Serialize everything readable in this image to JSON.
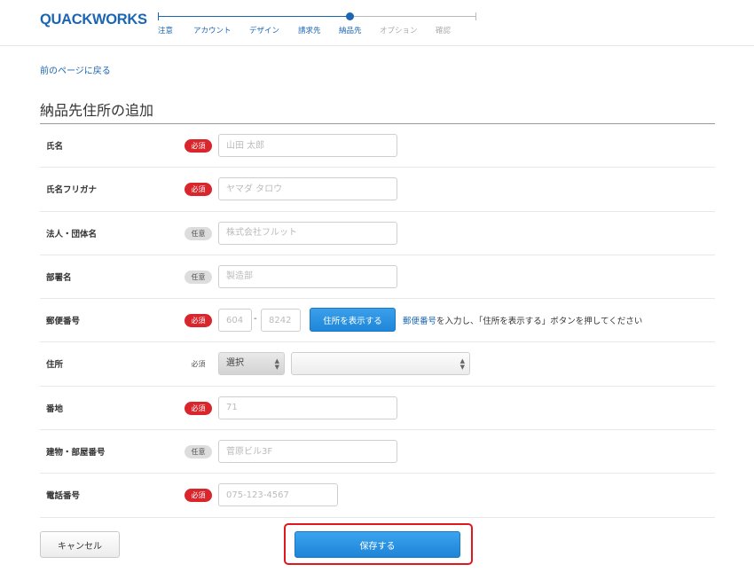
{
  "header": {
    "logo": "QUACKWORKS",
    "steps": [
      {
        "label": "注意",
        "state": "done"
      },
      {
        "label": "アカウント",
        "state": "done"
      },
      {
        "label": "デザイン",
        "state": "done"
      },
      {
        "label": "請求先",
        "state": "done"
      },
      {
        "label": "納品先",
        "state": "current"
      },
      {
        "label": "オプション",
        "state": "todo"
      },
      {
        "label": "確認",
        "state": "todo"
      }
    ]
  },
  "back_link": "前のページに戻る",
  "page_title": "納品先住所の追加",
  "badges": {
    "required": "必須",
    "optional": "任意"
  },
  "form": {
    "name": {
      "label": "氏名",
      "badge": "必須",
      "placeholder": "山田 太郎"
    },
    "furigana": {
      "label": "氏名フリガナ",
      "badge": "必須",
      "placeholder": "ヤマダ タロウ"
    },
    "company": {
      "label": "法人・団体名",
      "badge": "任意",
      "placeholder": "株式会社フルット"
    },
    "department": {
      "label": "部署名",
      "badge": "任意",
      "placeholder": "製造部"
    },
    "postal": {
      "label": "郵便番号",
      "badge": "必須",
      "placeholder1": "604",
      "placeholder2": "8242",
      "dash": "-",
      "button": "住所を表示する",
      "hint_link": "郵便番号",
      "hint_text": "を入力し、「住所を表示する」ボタンを押してください"
    },
    "address": {
      "label": "住所",
      "badge": "必須",
      "pref_value": "選択",
      "city_value": ""
    },
    "street": {
      "label": "番地",
      "badge": "必須",
      "placeholder": "71"
    },
    "building": {
      "label": "建物・部屋番号",
      "badge": "任意",
      "placeholder": "菅原ビル3F"
    },
    "phone": {
      "label": "電話番号",
      "badge": "必須",
      "placeholder": "075-123-4567"
    }
  },
  "buttons": {
    "cancel": "キャンセル",
    "save": "保存する"
  },
  "colors": {
    "brand": "#1b66b3",
    "required": "#d9262c",
    "primary_button": "#1f86d9",
    "highlight": "#e0181e"
  }
}
